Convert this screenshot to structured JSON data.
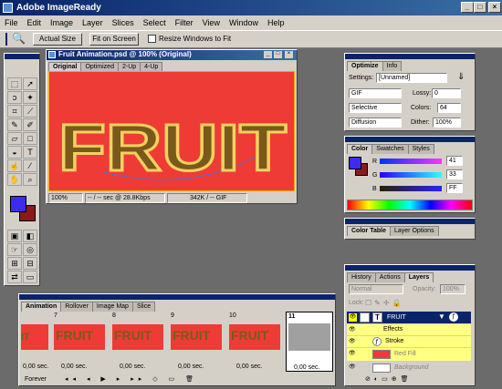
{
  "app": {
    "title": "Adobe ImageReady"
  },
  "menu": [
    "File",
    "Edit",
    "Image",
    "Layer",
    "Slices",
    "Select",
    "Filter",
    "View",
    "Window",
    "Help"
  ],
  "options_bar": {
    "actual_size": "Actual Size",
    "fit_on_screen": "Fit on Screen",
    "resize_windows": "Resize Windows to Fit"
  },
  "document": {
    "title": "Fruit Animation.psd @ 100% (Original)",
    "tabs": [
      "Original",
      "Optimized",
      "2-Up",
      "4-Up"
    ],
    "artwork_text": "FRUIT",
    "status": {
      "zoom": "100%",
      "time": "-- / -- sec @ 28.8Kbps",
      "size": "342K / -- GIF"
    }
  },
  "optimize": {
    "tabs": [
      "Optimize",
      "Info"
    ],
    "settings_label": "Settings:",
    "settings_value": "[Unnamed]",
    "format": "GIF",
    "lossy_label": "Lossy:",
    "lossy_value": "0",
    "reduction": "Selective",
    "colors_label": "Colors:",
    "colors_value": "64",
    "dither_method": "Diffusion",
    "dither_label": "Dither:",
    "dither_value": "100%"
  },
  "color": {
    "tabs": [
      "Color",
      "Swatches",
      "Styles"
    ],
    "r_label": "R",
    "r_value": "41",
    "g_label": "G",
    "g_value": "33",
    "b_label": "B",
    "b_value": "FF",
    "foreground": "#3c2cf0",
    "background": "#8a1a1a"
  },
  "color_table": {
    "tabs": [
      "Color Table",
      "Layer Options"
    ]
  },
  "layers": {
    "tabs": [
      "History",
      "Actions",
      "Layers"
    ],
    "blend_mode": "Normal",
    "opacity_label": "Opacity:",
    "opacity_value": "100%",
    "lock_label": "Lock:",
    "items": [
      {
        "name": "FRUIT",
        "selected": true
      },
      {
        "name": "Effects",
        "sub": true
      },
      {
        "name": "Stroke",
        "sub": true
      },
      {
        "name": "Red Fill"
      },
      {
        "name": "Background",
        "italic": true
      }
    ]
  },
  "animation": {
    "tabs": [
      "Animation",
      "Rollover",
      "Image Map",
      "Slice"
    ],
    "frames": [
      {
        "num": "",
        "delay": "0,00 sec."
      },
      {
        "num": "7",
        "delay": "0,00 sec."
      },
      {
        "num": "8",
        "delay": "0,00 sec."
      },
      {
        "num": "9",
        "delay": "0,00 sec."
      },
      {
        "num": "10",
        "delay": "0,00 sec."
      },
      {
        "num": "11",
        "delay": "0,00 sec."
      }
    ],
    "loop": "Forever"
  }
}
